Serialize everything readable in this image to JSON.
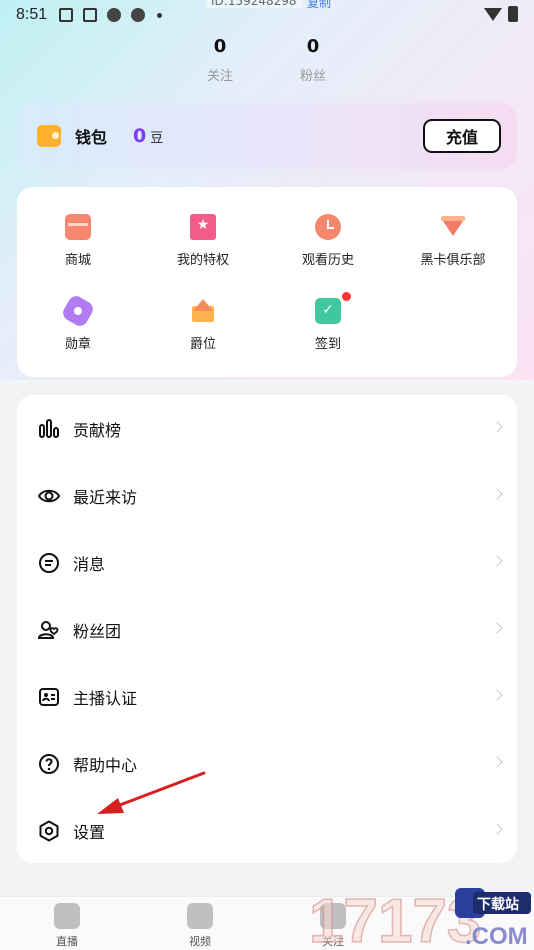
{
  "status_bar": {
    "time": "8:51",
    "id_text": "ID:159248298",
    "copy_label": "复制"
  },
  "stats": [
    {
      "value": "0",
      "label": "关注"
    },
    {
      "value": "0",
      "label": "粉丝"
    }
  ],
  "wallet": {
    "label": "钱包",
    "amount": "0",
    "unit": "豆",
    "recharge_label": "充值"
  },
  "features": [
    {
      "label": "商城",
      "icon": "shop-icon"
    },
    {
      "label": "我的特权",
      "icon": "privilege-icon"
    },
    {
      "label": "观看历史",
      "icon": "history-icon"
    },
    {
      "label": "黑卡俱乐部",
      "icon": "diamond-icon"
    },
    {
      "label": "勋章",
      "icon": "medal-icon"
    },
    {
      "label": "爵位",
      "icon": "crown-icon"
    },
    {
      "label": "签到",
      "icon": "calendar-check-icon"
    }
  ],
  "menu": [
    {
      "label": "贡献榜",
      "icon": "bar-chart-icon"
    },
    {
      "label": "最近来访",
      "icon": "eye-icon"
    },
    {
      "label": "消息",
      "icon": "message-icon"
    },
    {
      "label": "粉丝团",
      "icon": "fans-icon"
    },
    {
      "label": "主播认证",
      "icon": "id-card-icon"
    },
    {
      "label": "帮助中心",
      "icon": "help-icon"
    },
    {
      "label": "设置",
      "icon": "settings-icon"
    }
  ],
  "tabs": [
    {
      "label": "直播"
    },
    {
      "label": "视频"
    },
    {
      "label": "关注"
    }
  ],
  "watermark": {
    "number": "17173",
    "text": "下载站",
    "domain": ".COM"
  }
}
